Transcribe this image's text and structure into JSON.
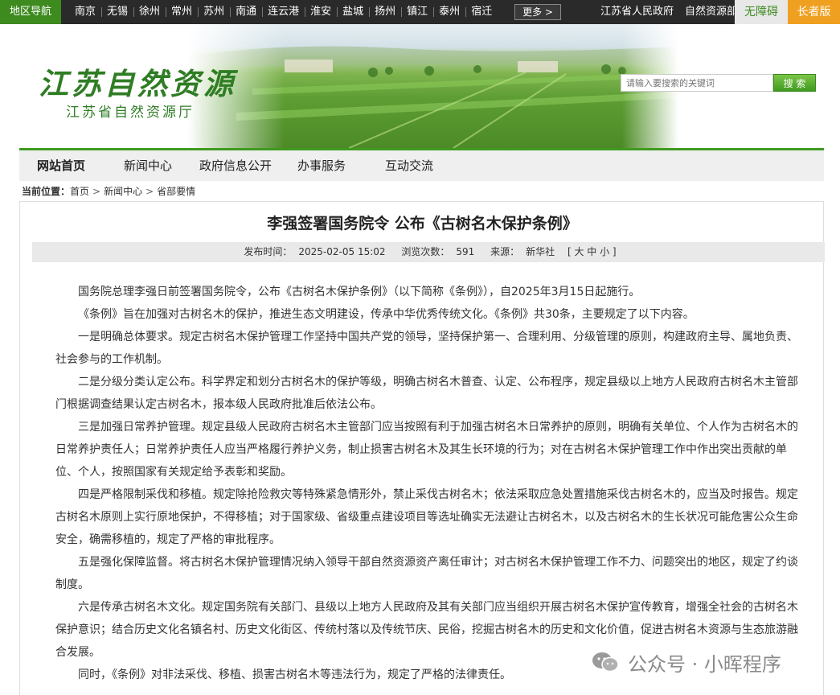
{
  "topbar": {
    "region_label": "地区导航",
    "cities": [
      "南京",
      "无锡",
      "徐州",
      "常州",
      "苏州",
      "南通",
      "连云港",
      "淮安",
      "盐城",
      "扬州",
      "镇江",
      "泰州",
      "宿迁"
    ],
    "more_label": "更多 >",
    "links": [
      "江苏省人民政府",
      "自然资源部"
    ],
    "accessibility_label": "无障碍",
    "elder_label": "长者版"
  },
  "banner": {
    "logo_title": "江苏自然资源",
    "logo_subtitle": "江苏省自然资源厅",
    "search_placeholder": "请输入要搜索的关键词",
    "search_button": "搜 索"
  },
  "nav": {
    "items": [
      "网站首页",
      "新闻中心",
      "政府信息公开",
      "办事服务",
      "互动交流"
    ]
  },
  "breadcrumb": {
    "label": "当前位置：",
    "items": [
      "首页",
      "新闻中心",
      "省部要情"
    ]
  },
  "article": {
    "title": "李强签署国务院令 公布《古树名木保护条例》",
    "meta": {
      "publish_label": "发布时间：",
      "publish_time": "2025-02-05 15:02",
      "views_label": "浏览次数：",
      "views": "591",
      "source_label": "来源：",
      "source": "新华社",
      "size_control": "[ 大 中 小 ]"
    },
    "paragraphs": [
      "国务院总理李强日前签署国务院令，公布《古树名木保护条例》（以下简称《条例》），自2025年3月15日起施行。",
      "《条例》旨在加强对古树名木的保护，推进生态文明建设，传承中华优秀传统文化。《条例》共30条，主要规定了以下内容。",
      "一是明确总体要求。规定古树名木保护管理工作坚持中国共产党的领导，坚持保护第一、合理利用、分级管理的原则，构建政府主导、属地负责、社会参与的工作机制。",
      "二是分级分类认定公布。科学界定和划分古树名木的保护等级，明确古树名木普查、认定、公布程序，规定县级以上地方人民政府古树名木主管部门根据调查结果认定古树名木，报本级人民政府批准后依法公布。",
      "三是加强日常养护管理。规定县级人民政府古树名木主管部门应当按照有利于加强古树名木日常养护的原则，明确有关单位、个人作为古树名木的日常养护责任人；日常养护责任人应当严格履行养护义务，制止损害古树名木及其生长环境的行为；对在古树名木保护管理工作中作出突出贡献的单位、个人，按照国家有关规定给予表彰和奖励。",
      "四是严格限制采伐和移植。规定除抢险救灾等特殊紧急情形外，禁止采伐古树名木；依法采取应急处置措施采伐古树名木的，应当及时报告。规定古树名木原则上实行原地保护，不得移植；对于国家级、省级重点建设项目等选址确实无法避让古树名木，以及古树名木的生长状况可能危害公众生命安全，确需移植的，规定了严格的审批程序。",
      "五是强化保障监督。将古树名木保护管理情况纳入领导干部自然资源资产离任审计；对古树名木保护管理工作不力、问题突出的地区，规定了约谈制度。",
      "六是传承古树名木文化。规定国务院有关部门、县级以上地方人民政府及其有关部门应当组织开展古树名木保护宣传教育，增强全社会的古树名木保护意识；结合历史文化名镇名村、历史文化街区、传统村落以及传统节庆、民俗，挖掘古树名木的历史和文化价值，促进古树名木资源与生态旅游融合发展。",
      "同时，《条例》对非法采伐、移植、损害古树名木等违法行为，规定了严格的法律责任。"
    ]
  },
  "watermark": {
    "text": "公众号 · 小晖程序"
  },
  "colors": {
    "brand_green": "#3f9a20",
    "topbar_bg": "#2a2a2a",
    "elder_orange": "#f0a020"
  }
}
